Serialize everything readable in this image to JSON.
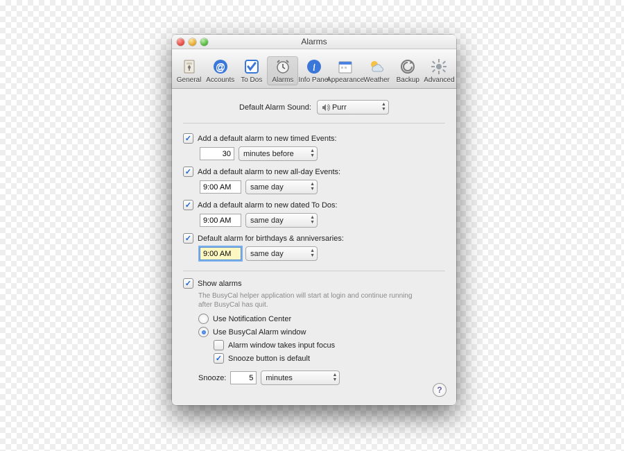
{
  "window": {
    "title": "Alarms"
  },
  "toolbar": {
    "items": [
      {
        "id": "general",
        "label": "General"
      },
      {
        "id": "accounts",
        "label": "Accounts"
      },
      {
        "id": "todos",
        "label": "To Dos"
      },
      {
        "id": "alarms",
        "label": "Alarms",
        "selected": true
      },
      {
        "id": "infopanel",
        "label": "Info Panel"
      },
      {
        "id": "appearance",
        "label": "Appearance"
      },
      {
        "id": "weather",
        "label": "Weather"
      },
      {
        "id": "backup",
        "label": "Backup"
      },
      {
        "id": "advanced",
        "label": "Advanced"
      }
    ]
  },
  "sound": {
    "label": "Default Alarm Sound:",
    "value": "Purr"
  },
  "defaults": {
    "timed": {
      "checked": true,
      "label": "Add a default alarm to new timed Events:",
      "value": "30",
      "unit": "minutes before"
    },
    "allday": {
      "checked": true,
      "label": "Add a default alarm to new all-day Events:",
      "value": "9:00 AM",
      "unit": "same day"
    },
    "todos": {
      "checked": true,
      "label": "Add a default alarm to new dated To Dos:",
      "value": "9:00 AM",
      "unit": "same day"
    },
    "birthday": {
      "checked": true,
      "label": "Default alarm for birthdays & anniversaries:",
      "value": "9:00 AM",
      "unit": "same day",
      "focused": true
    }
  },
  "show": {
    "checked": true,
    "label": "Show alarms",
    "help": "The BusyCal helper application will start at login and continue running after BusyCal has quit.",
    "mode": "busycal",
    "notification_label": "Use Notification Center",
    "busycal_label": "Use BusyCal Alarm window",
    "focus": {
      "checked": false,
      "label": "Alarm window takes input focus"
    },
    "snooze_default": {
      "checked": true,
      "label": "Snooze button is default"
    }
  },
  "snooze": {
    "label": "Snooze:",
    "value": "5",
    "unit": "minutes"
  },
  "help_button": "?"
}
